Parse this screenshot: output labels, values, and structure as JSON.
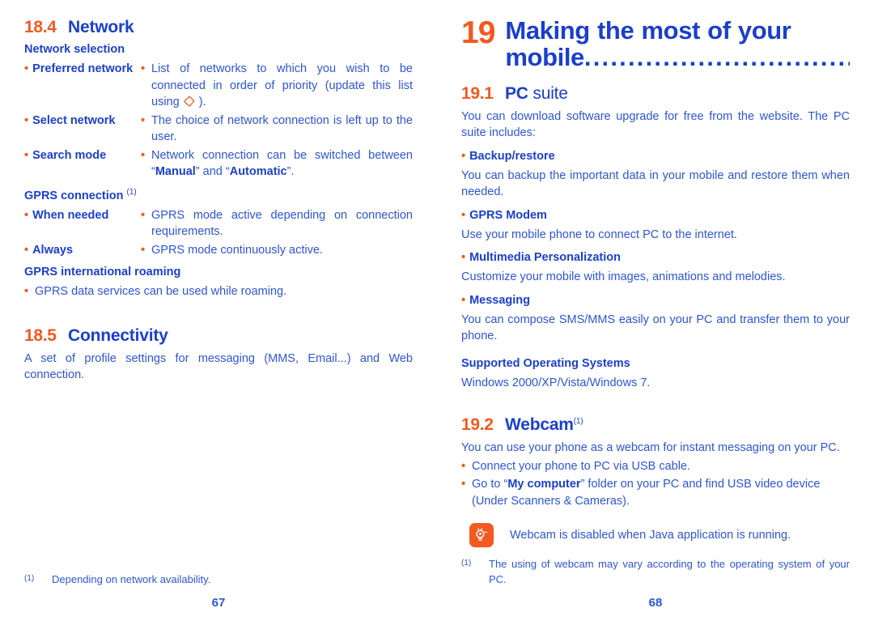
{
  "theme": {
    "orange": "#F4591F",
    "heading_blue": "#1B3FCC",
    "body_blue": "#2E55D4"
  },
  "left_page": {
    "page_number": "67",
    "section_18_4": {
      "number": "18.4",
      "title": "Network",
      "sub_heading": "Network selection",
      "rows": [
        {
          "term": "Preferred network",
          "desc_before_glyph": "List of networks to which you wish to be connected in order of priority (update this list using ",
          "glyph": "key-glyph",
          "desc_after_glyph": " )."
        },
        {
          "term": "Select network",
          "desc": "The choice of network connection is left up to the user."
        },
        {
          "term": "Search mode",
          "desc_part1": "Network connection can be switched between “",
          "desc_bold1": "Manual",
          "desc_part2": "” and “",
          "desc_bold2": "Automatic",
          "desc_part3": "”."
        }
      ],
      "gprs_connection_heading": "GPRS connection",
      "gprs_connection_footnote_mark": "(1)",
      "gprs_rows": [
        {
          "term": "When needed",
          "desc": "GPRS mode active depending on connection requirements."
        },
        {
          "term": "Always",
          "desc": "GPRS mode continuously active."
        }
      ],
      "roaming_heading": "GPRS international roaming",
      "roaming_bullet": "GPRS data services can be used while roaming."
    },
    "section_18_5": {
      "number": "18.5",
      "title": "Connectivity",
      "paragraph": "A set of profile settings for messaging (MMS, Email...) and Web connection."
    },
    "footnote": {
      "mark": "(1)",
      "text": "Depending on network availability."
    }
  },
  "right_page": {
    "page_number": "68",
    "chapter": {
      "number": "19",
      "title": "Making the most of your mobile",
      "leader": "........................................"
    },
    "section_19_1": {
      "number": "19.1",
      "title_bold": "PC",
      "title_light": "suite",
      "intro": "You can download software upgrade for free from the website. The PC suite includes:",
      "items": [
        {
          "heading": "Backup/restore",
          "text": "You can backup the important data in your mobile and restore them when needed."
        },
        {
          "heading": "GPRS Modem",
          "text": "Use your mobile phone to connect PC to the internet."
        },
        {
          "heading": "Multimedia Personalization",
          "text": "Customize your mobile with images, animations and melodies."
        },
        {
          "heading": "Messaging",
          "text": "You can compose SMS/MMS easily on your PC and transfer them to your phone."
        }
      ],
      "os_heading": "Supported Operating Systems",
      "os_text": "Windows 2000/XP/Vista/Windows 7."
    },
    "section_19_2": {
      "number": "19.2",
      "title": "Webcam",
      "footnote_mark": "(1)",
      "intro": "You can use your phone as a webcam for instant messaging on your PC.",
      "bullets": [
        {
          "text": "Connect your phone to PC via USB cable."
        },
        {
          "part1": "Go to “",
          "bold": "My computer",
          "part2": "” folder on your PC and find USB video device (Under Scanners & Cameras)."
        }
      ],
      "tip": {
        "icon": "lightbulb-icon",
        "text": "Webcam is disabled when Java application is running."
      }
    },
    "footnote": {
      "mark": "(1)",
      "text": "The using of webcam may vary according to the operating system of your PC."
    }
  }
}
